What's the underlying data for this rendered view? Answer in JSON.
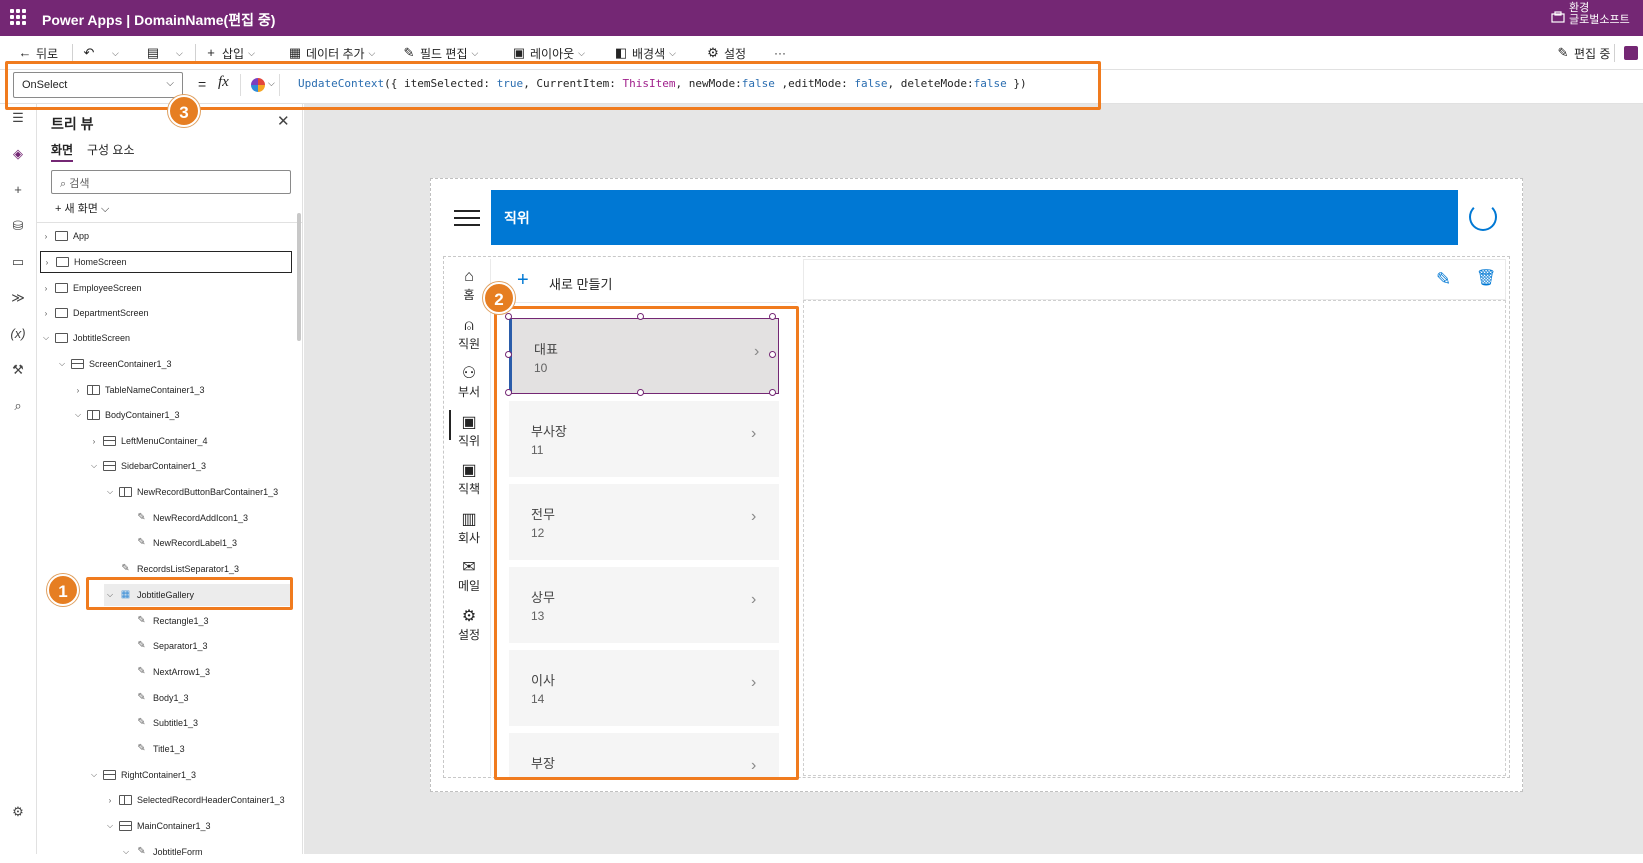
{
  "app": {
    "title": "Power Apps  |  DomainName(편집 중)",
    "environment_label": "환경",
    "environment_name": "글로벌소프트"
  },
  "command_bar": {
    "back": "뒤로",
    "insert": "삽입",
    "add_data": "데이터 추가",
    "edit_fields": "필드 편집",
    "layout": "레이아웃",
    "background": "배경색",
    "settings": "설정",
    "more": "···",
    "editing_status": "편집 중"
  },
  "formula_bar": {
    "property": "OnSelect",
    "equals": "=",
    "fx": "fx",
    "formula_parts": {
      "fn": "UpdateContext",
      "p1": "({ itemSelected: ",
      "v1": "true",
      "p2": ", CurrentItem: ",
      "v2": "ThisItem",
      "p3": ", newMode:",
      "v3": "false",
      "p4": " ,editMode: ",
      "v4": "false",
      "p5": ", deleteMode:",
      "v5": "false",
      "p6": " })"
    }
  },
  "tree_view": {
    "title": "트리 뷰",
    "tabs": [
      "화면",
      "구성 요소"
    ],
    "search_placeholder": "검색",
    "new_screen": "새 화면",
    "nodes": [
      {
        "label": "App"
      },
      {
        "label": "HomeScreen"
      },
      {
        "label": "EmployeeScreen"
      },
      {
        "label": "DepartmentScreen"
      },
      {
        "label": "JobtitleScreen"
      },
      {
        "label": "ScreenContainer1_3"
      },
      {
        "label": "TableNameContainer1_3"
      },
      {
        "label": "BodyContainer1_3"
      },
      {
        "label": "LeftMenuContainer_4"
      },
      {
        "label": "SidebarContainer1_3"
      },
      {
        "label": "NewRecordButtonBarContainer1_3"
      },
      {
        "label": "NewRecordAddIcon1_3"
      },
      {
        "label": "NewRecordLabel1_3"
      },
      {
        "label": "RecordsListSeparator1_3"
      },
      {
        "label": "JobtitleGallery"
      },
      {
        "label": "Rectangle1_3"
      },
      {
        "label": "Separator1_3"
      },
      {
        "label": "NextArrow1_3"
      },
      {
        "label": "Body1_3"
      },
      {
        "label": "Subtitle1_3"
      },
      {
        "label": "Title1_3"
      },
      {
        "label": "RightContainer1_3"
      },
      {
        "label": "SelectedRecordHeaderContainer1_3"
      },
      {
        "label": "MainContainer1_3"
      },
      {
        "label": "JobtitleForm"
      }
    ]
  },
  "canvas_app": {
    "header_title": "직위",
    "left_menu": [
      "홈",
      "직원",
      "부서",
      "직위",
      "직책",
      "회사",
      "메일",
      "설정"
    ],
    "new_record_label": "새로 만들기",
    "gallery_items": [
      {
        "title": "대표",
        "subtitle": "10"
      },
      {
        "title": "부사장",
        "subtitle": "11"
      },
      {
        "title": "전무",
        "subtitle": "12"
      },
      {
        "title": "상무",
        "subtitle": "13"
      },
      {
        "title": "이사",
        "subtitle": "14"
      },
      {
        "title": "부장",
        "subtitle": ""
      }
    ]
  },
  "callouts": [
    "1",
    "2",
    "3"
  ],
  "colors": {
    "brand": "#742774",
    "header_blue": "#0078d4",
    "callout": "#f07b1e"
  }
}
